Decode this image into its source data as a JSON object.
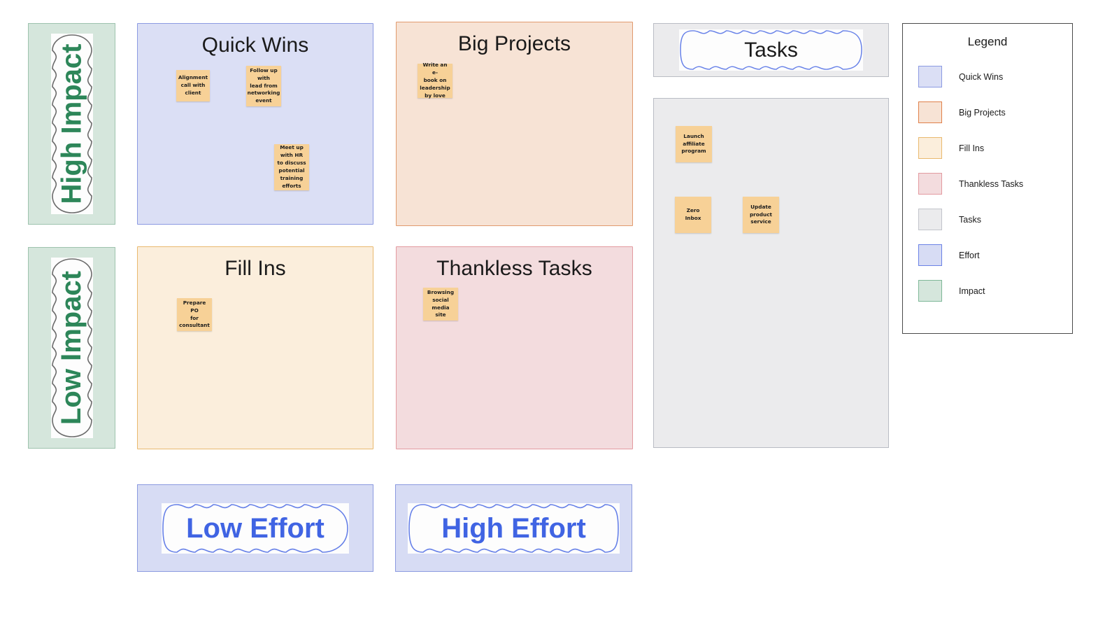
{
  "board": {
    "background": "#ffffff",
    "note_color": "#f7d197",
    "note_text_color": "#1c1c1c"
  },
  "axes": {
    "impact": {
      "label": "Impact",
      "fill": "#d5e6dc",
      "border": "#9ec3ae",
      "text_color": "#2d8659",
      "cloud_stroke": "#6b6b6b",
      "levels": [
        {
          "label": "High Impact"
        },
        {
          "label": "Low Impact"
        }
      ]
    },
    "effort": {
      "label": "Effort",
      "fill": "#d7dcf4",
      "border": "#8b9ae0",
      "text_color": "#4064e3",
      "cloud_stroke": "#6680e8",
      "levels": [
        {
          "label": "Low Effort"
        },
        {
          "label": "High Effort"
        }
      ]
    }
  },
  "quadrants": [
    {
      "id": "quick-wins",
      "title": "Quick Wins",
      "fill": "#dbdff5",
      "border": "#8c9ae2",
      "notes": [
        {
          "text": "Alignment\ncall with\nclient"
        },
        {
          "text": "Follow up\nwith\nlead from\nnetworking\nevent"
        },
        {
          "text": "Meet up\nwith HR\nto discuss\npotential\ntraining\nefforts"
        }
      ]
    },
    {
      "id": "big-projects",
      "title": "Big Projects",
      "fill": "#f7e3d5",
      "border": "#e09a6e",
      "notes": [
        {
          "text": "Write an e-\nbook on\nleadership\nby love"
        }
      ]
    },
    {
      "id": "fill-ins",
      "title": "Fill Ins",
      "fill": "#fbeedc",
      "border": "#e9b96e",
      "notes": [
        {
          "text": "Prepare PO\nfor\nconsultant"
        }
      ]
    },
    {
      "id": "thankless-tasks",
      "title": "Thankless Tasks",
      "fill": "#f3dcde",
      "border": "#e39aa0",
      "notes": [
        {
          "text": "Browsing\nsocial media\nsite"
        }
      ]
    }
  ],
  "tasks": {
    "title": "Tasks",
    "fill": "#ebebed",
    "border": "#b9bcc4",
    "notes": [
      {
        "text": "Launch\naffiliate\nprogram"
      },
      {
        "text": "Zero\nInbox"
      },
      {
        "text": "Update\nproduct\nservice"
      }
    ]
  },
  "legend": {
    "title": "Legend",
    "border": "#4a4a4a",
    "items": [
      {
        "label": "Quick Wins",
        "fill": "#dbdff5",
        "border": "#8c9ae2"
      },
      {
        "label": "Big Projects",
        "fill": "#f7e3d5",
        "border": "#e0804a"
      },
      {
        "label": "Fill Ins",
        "fill": "#fbeedc",
        "border": "#e9b96e"
      },
      {
        "label": "Thankless Tasks",
        "fill": "#f3dcde",
        "border": "#e39aa0"
      },
      {
        "label": "Tasks",
        "fill": "#ebebed",
        "border": "#c2c4cb"
      },
      {
        "label": "Effort",
        "fill": "#d7dcf4",
        "border": "#6b82e6"
      },
      {
        "label": "Impact",
        "fill": "#d5e6dc",
        "border": "#7fb898"
      }
    ]
  }
}
